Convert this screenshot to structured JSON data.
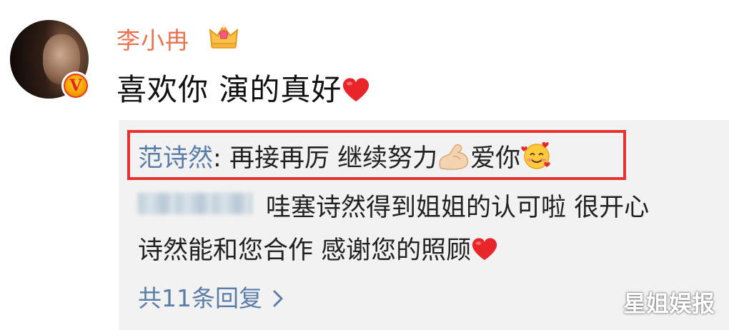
{
  "comment": {
    "username": "李小冉",
    "text": "喜欢你 演的真好"
  },
  "replies": [
    {
      "name": "范诗然",
      "separator": ": ",
      "text": "再接再厉 继续努力",
      "text_after_emoji": "爱你",
      "highlighted": true
    },
    {
      "line1": "哇塞诗然得到姐姐的认可啦 很开心",
      "line2": "诗然能和您合作 感谢您的照顾"
    }
  ],
  "more_replies": "共11条回复",
  "watermark": "星姐娱报",
  "icons": [
    "avatar",
    "verified-v-badge-icon",
    "crown-icon",
    "heart-icon",
    "flexed-bicep-icon",
    "smiling-face-with-hearts-icon",
    "chevron-right-icon"
  ],
  "colors": {
    "username": "#eb7350",
    "link": "#5b7ea8",
    "highlight_border": "#e8322f",
    "reply_bg": "#f2f2f2"
  }
}
